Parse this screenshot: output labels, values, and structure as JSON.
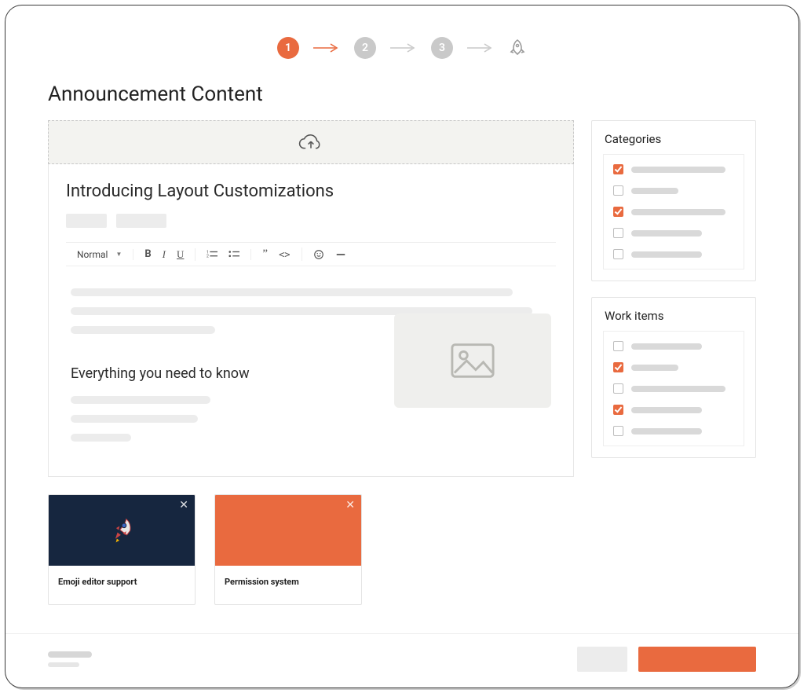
{
  "stepper": {
    "steps": [
      "1",
      "2",
      "3"
    ],
    "active_index": 0
  },
  "page_title": "Announcement Content",
  "editor": {
    "post_title": "Introducing Layout Customizations",
    "format_label": "Normal",
    "subhead": "Everything you need to know"
  },
  "attachments": [
    {
      "title": "Emoji editor support",
      "theme": "navy",
      "has_rocket": true
    },
    {
      "title": "Permission system",
      "theme": "orange",
      "has_rocket": false
    }
  ],
  "sidebar": {
    "categories": {
      "title": "Categories",
      "items": [
        {
          "checked": true,
          "len": "long"
        },
        {
          "checked": false,
          "len": "short"
        },
        {
          "checked": true,
          "len": "long"
        },
        {
          "checked": false,
          "len": "med"
        },
        {
          "checked": false,
          "len": "med"
        }
      ]
    },
    "work_items": {
      "title": "Work items",
      "items": [
        {
          "checked": false,
          "len": "med"
        },
        {
          "checked": true,
          "len": "short"
        },
        {
          "checked": false,
          "len": "long"
        },
        {
          "checked": true,
          "len": "med"
        },
        {
          "checked": false,
          "len": "med"
        }
      ]
    }
  },
  "colors": {
    "accent": "#e96a3f",
    "navy": "#16263f",
    "muted": "#c9c9c9"
  }
}
